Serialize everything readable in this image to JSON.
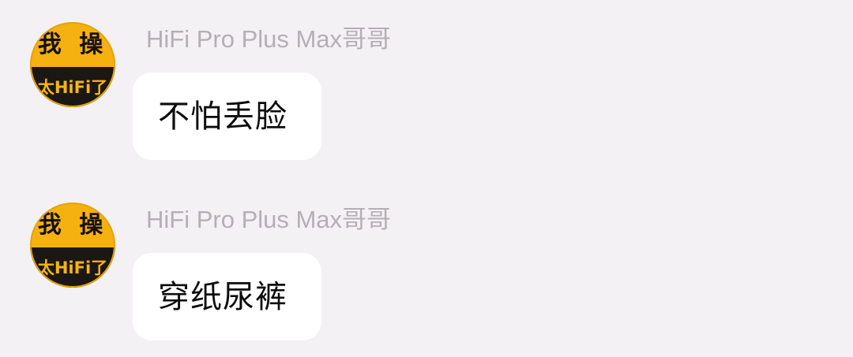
{
  "messages": [
    {
      "sender": "HiFi Pro Plus Max哥哥",
      "avatar": {
        "top_text": "我 操",
        "band_text": "太HiFi了"
      },
      "text": "不怕丢脸"
    },
    {
      "sender": "HiFi Pro Plus Max哥哥",
      "avatar": {
        "top_text": "我 操",
        "band_text": "太HiFi了"
      },
      "text": "穿纸尿裤"
    }
  ],
  "colors": {
    "background": "#f4f1f4",
    "bubble": "#ffffff",
    "sender_name": "#b3afb4",
    "avatar_yellow": "#f5b10f",
    "avatar_band": "#1a1714"
  }
}
